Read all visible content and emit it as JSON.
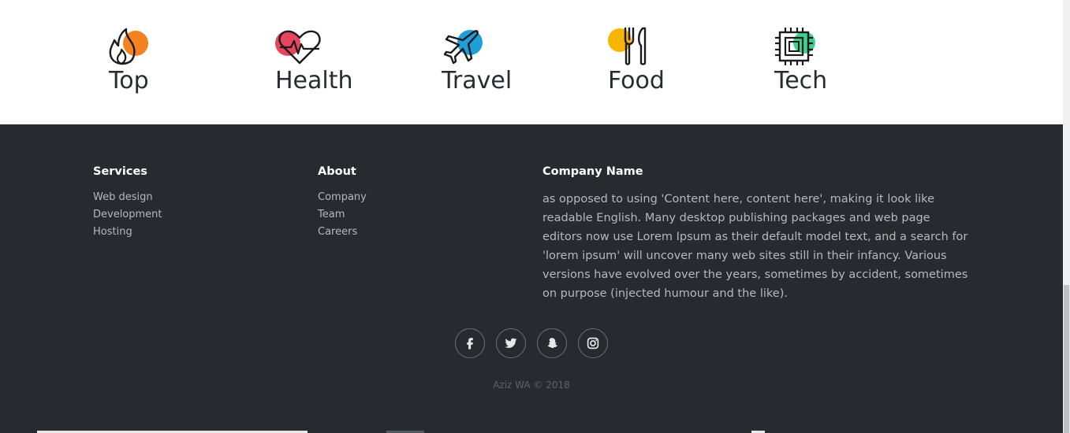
{
  "categories": [
    {
      "label": "Top",
      "icon": "flame-icon",
      "color": "#f58220"
    },
    {
      "label": "Health",
      "icon": "heart-pulse-icon",
      "color": "#e8445f"
    },
    {
      "label": "Travel",
      "icon": "airplane-icon",
      "color": "#1e9fd9"
    },
    {
      "label": "Food",
      "icon": "fork-knife-icon",
      "color": "#f7b500"
    },
    {
      "label": "Tech",
      "icon": "chip-icon",
      "color": "#3ed18c"
    }
  ],
  "footer": {
    "services": {
      "title": "Services",
      "links": [
        "Web design",
        "Development",
        "Hosting"
      ]
    },
    "about": {
      "title": "About",
      "links": [
        "Company",
        "Team",
        "Careers"
      ]
    },
    "company": {
      "title": "Company Name",
      "text": "as opposed to using 'Content here, content here', making it look like readable English. Many desktop publishing packages and web page editors now use Lorem Ipsum as their default model text, and a search for 'lorem ipsum' will uncover many web sites still in their infancy. Various versions have evolved over the years, sometimes by accident, sometimes on purpose (injected humour and the like)."
    },
    "social": [
      "facebook-icon",
      "twitter-icon",
      "snapchat-icon",
      "instagram-icon"
    ],
    "copyright": "Aziz WA © 2018"
  }
}
